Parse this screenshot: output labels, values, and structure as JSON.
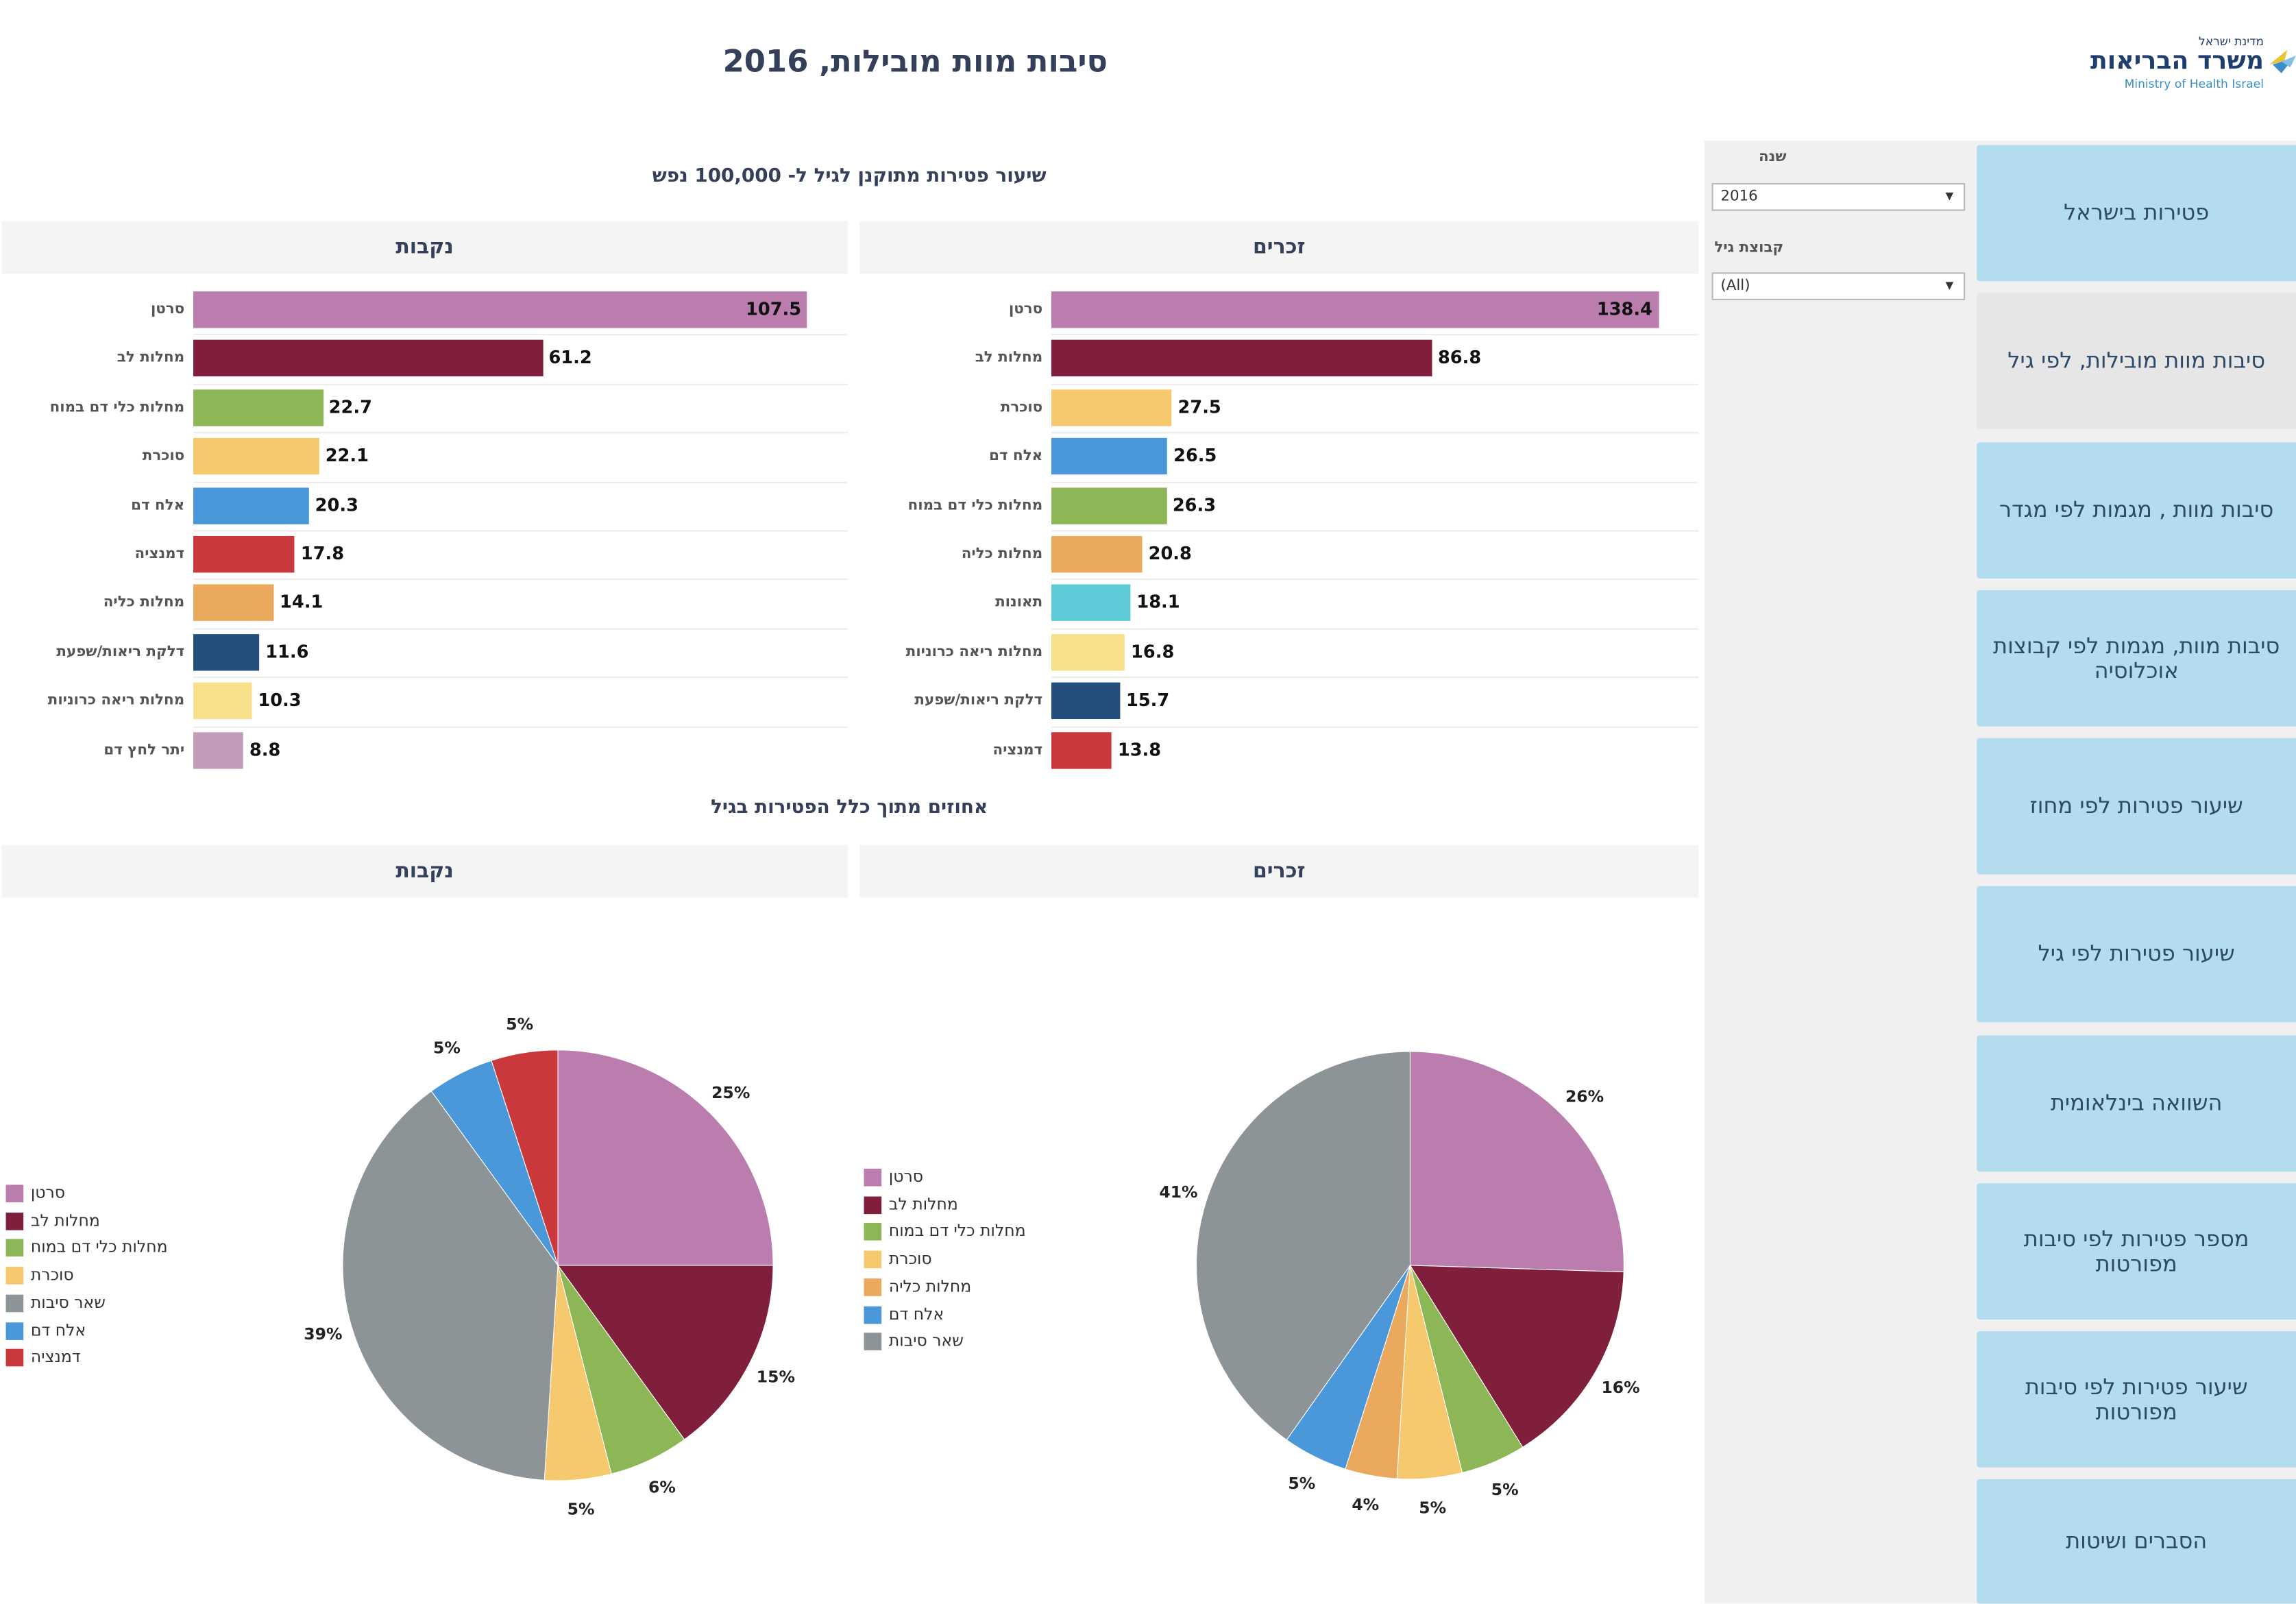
{
  "header": {
    "title": "סיבות מוות מובילות, 2016"
  },
  "logo": {
    "top": "מדינת ישראל",
    "main": "משרד הבריאות",
    "en": "Ministry of Health Israel"
  },
  "filters": [
    {
      "label": "שנה",
      "value": "2016"
    },
    {
      "label": "קבוצת גיל",
      "value": "(All)"
    }
  ],
  "nav": [
    {
      "label": "פטירות בישראל",
      "active": false
    },
    {
      "label": "סיבות מוות מובילות, לפי גיל",
      "active": true
    },
    {
      "label": "סיבות מוות , מגמות לפי מגדר",
      "active": false
    },
    {
      "label": "סיבות מוות, מגמות לפי קבוצות אוכלוסיה",
      "active": false
    },
    {
      "label": "שיעור פטירות לפי מחוז",
      "active": false
    },
    {
      "label": "שיעור פטירות לפי גיל",
      "active": false
    },
    {
      "label": "השוואה בינלאומית",
      "active": false
    },
    {
      "label": "מספר פטירות לפי סיבות מפורטות",
      "active": false
    },
    {
      "label": "שיעור פטירות לפי סיבות מפורטות",
      "active": false
    },
    {
      "label": "הסברים ושיטות",
      "active": false
    }
  ],
  "sections": {
    "bars_title": "שיעור פטירות מתוקנן לגיל ל- 100,000 נפש",
    "pies_title": "אחוזים מתוך כלל הפטירות בגיל",
    "male": "זכרים",
    "female": "נקבות"
  },
  "colors": {
    "cancer": "#bb7cae",
    "heart": "#7f1f3c",
    "cerebro": "#8db656",
    "diabetes": "#f6c96f",
    "sepsis": "#4a98d9",
    "dementia": "#c9383a",
    "kidney": "#eba95e",
    "accidents": "#5ecbd8",
    "copd": "#f8e08a",
    "pneumonia": "#234f7a",
    "hypertension": "#c29bb9",
    "other": "#8d9497"
  },
  "chart_data": [
    {
      "type": "bar",
      "title": "שיעור פטירות מתוקנן לגיל ל- 100,000 נפש",
      "panel": "זכרים",
      "orientation": "horizontal",
      "categories": [
        "סרטן",
        "מחלות לב",
        "סוכרת",
        "אלח דם",
        "מחלות כלי דם במוח",
        "מחלות כליה",
        "תאונות",
        "מחלות ריאה כרוניות",
        "דלקת ריאות/שפעת",
        "דמנציה"
      ],
      "values": [
        138.4,
        86.8,
        27.5,
        26.5,
        26.3,
        20.8,
        18.1,
        16.8,
        15.7,
        13.8
      ],
      "color_keys": [
        "cancer",
        "heart",
        "diabetes",
        "sepsis",
        "cerebro",
        "kidney",
        "accidents",
        "copd",
        "pneumonia",
        "dementia"
      ]
    },
    {
      "type": "bar",
      "title": "שיעור פטירות מתוקנן לגיל ל- 100,000 נפש",
      "panel": "נקבות",
      "orientation": "horizontal",
      "categories": [
        "סרטן",
        "מחלות לב",
        "מחלות כלי דם במוח",
        "סוכרת",
        "אלח דם",
        "דמנציה",
        "מחלות כליה",
        "דלקת ריאות/שפעת",
        "מחלות ריאה כרוניות",
        "יתר לחץ דם"
      ],
      "values": [
        107.5,
        61.2,
        22.7,
        22.1,
        20.3,
        17.8,
        14.1,
        11.6,
        10.3,
        8.8
      ],
      "color_keys": [
        "cancer",
        "heart",
        "cerebro",
        "diabetes",
        "sepsis",
        "dementia",
        "kidney",
        "pneumonia",
        "copd",
        "hypertension"
      ]
    },
    {
      "type": "pie",
      "title": "אחוזים מתוך כלל הפטירות בגיל",
      "panel": "זכרים",
      "categories": [
        "סרטן",
        "מחלות לב",
        "מחלות כלי דם במוח",
        "סוכרת",
        "מחלות כליה",
        "אלח דם",
        "שאר סיבות"
      ],
      "values": [
        26,
        16,
        5,
        5,
        4,
        5,
        41
      ],
      "color_keys": [
        "cancer",
        "heart",
        "cerebro",
        "diabetes",
        "kidney",
        "sepsis",
        "other"
      ]
    },
    {
      "type": "pie",
      "title": "אחוזים מתוך כלל הפטירות בגיל",
      "panel": "נקבות",
      "categories": [
        "סרטן",
        "מחלות לב",
        "מחלות כלי דם במוח",
        "סוכרת",
        "שאר סיבות",
        "אלח דם",
        "דמנציה"
      ],
      "values": [
        25,
        15,
        6,
        5,
        39,
        5,
        5
      ],
      "color_keys": [
        "cancer",
        "heart",
        "cerebro",
        "diabetes",
        "other",
        "sepsis",
        "dementia"
      ]
    }
  ]
}
